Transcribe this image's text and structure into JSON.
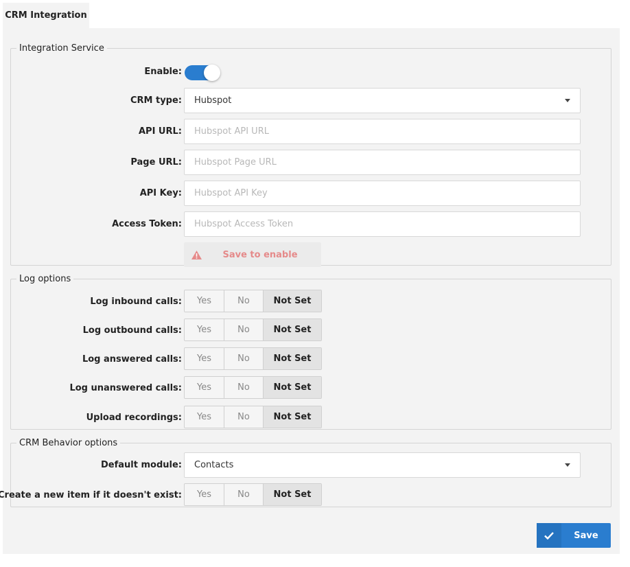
{
  "tab": {
    "label": "CRM Integration"
  },
  "integration": {
    "legend": "Integration Service",
    "enable_label": "Enable:",
    "enabled": true,
    "crm_type_label": "CRM type:",
    "crm_type_value": "Hubspot",
    "api_url_label": "API URL:",
    "api_url_placeholder": "Hubspot API URL",
    "page_url_label": "Page URL:",
    "page_url_placeholder": "Hubspot Page URL",
    "api_key_label": "API Key:",
    "api_key_placeholder": "Hubspot API Key",
    "access_token_label": "Access Token:",
    "access_token_placeholder": "Hubspot Access Token",
    "save_to_enable": "Save to enable"
  },
  "log_options": {
    "legend": "Log options",
    "options": {
      "yes": "Yes",
      "no": "No",
      "not_set": "Not Set"
    },
    "rows": [
      {
        "label": "Log inbound calls:",
        "selected": "Not Set"
      },
      {
        "label": "Log outbound calls:",
        "selected": "Not Set"
      },
      {
        "label": "Log answered calls:",
        "selected": "Not Set"
      },
      {
        "label": "Log unanswered calls:",
        "selected": "Not Set"
      },
      {
        "label": "Upload recordings:",
        "selected": "Not Set"
      }
    ]
  },
  "behavior": {
    "legend": "CRM Behavior options",
    "default_module_label": "Default module:",
    "default_module_value": "Contacts",
    "create_label": "Create a new item if it doesn't exist:",
    "create_selected": "Not Set"
  },
  "footer": {
    "save_label": "Save"
  },
  "colors": {
    "accent": "#2a7dcf",
    "warning": "#e58a8a",
    "panel_bg": "#f3f3f3"
  }
}
